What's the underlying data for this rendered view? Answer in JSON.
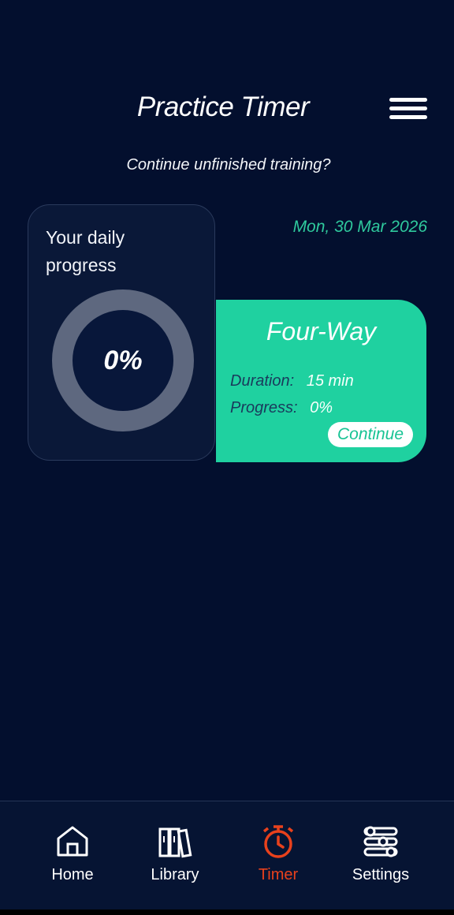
{
  "header": {
    "title": "Practice Timer",
    "menu_icon": "hamburger-menu-icon"
  },
  "prompt": "Continue unfinished training?",
  "progress": {
    "label": "Your daily progress",
    "value": "0%"
  },
  "date": "Mon, 30 Mar 2026",
  "session": {
    "title": "Four-Way",
    "duration_label": "Duration:",
    "duration_value": "15 min",
    "progress_label": "Progress:",
    "progress_value": "0%",
    "continue_label": "Continue"
  },
  "nav": {
    "items": [
      {
        "label": "Home",
        "icon": "home-icon"
      },
      {
        "label": "Library",
        "icon": "library-icon"
      },
      {
        "label": "Timer",
        "icon": "timer-icon",
        "active": true
      },
      {
        "label": "Settings",
        "icon": "settings-icon"
      }
    ]
  },
  "colors": {
    "background": "#030f2e",
    "accent": "#1fd1a0",
    "active_tab": "#e8411c",
    "date": "#2fc99d"
  }
}
